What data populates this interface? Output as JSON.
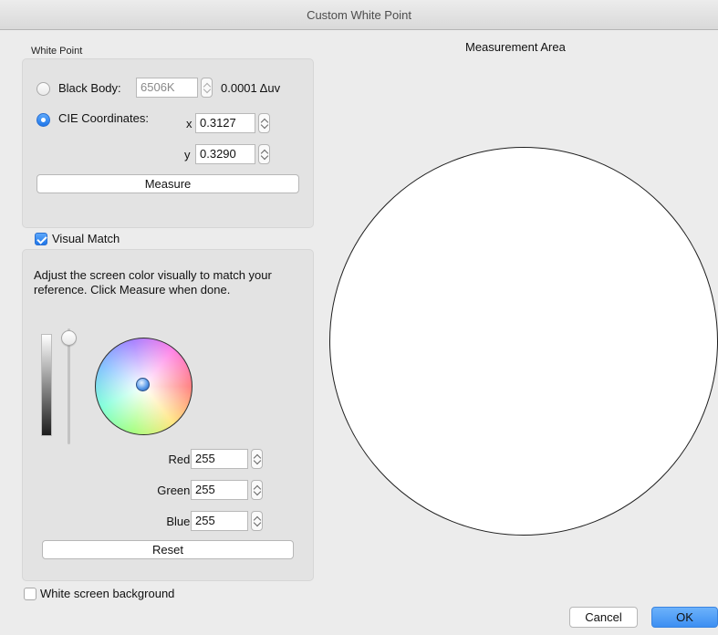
{
  "window": {
    "title": "Custom White Point"
  },
  "white_point": {
    "section_label": "White Point",
    "black_body": {
      "label": "Black Body:",
      "value": "6506K",
      "delta": "0.0001 Δuv",
      "selected": false
    },
    "cie": {
      "label": "CIE Coordinates:",
      "selected": true,
      "x_label": "x",
      "x_value": "0.3127",
      "y_label": "y",
      "y_value": "0.3290"
    },
    "measure_button": "Measure"
  },
  "visual_match": {
    "checkbox_label": "Visual Match",
    "checked": true,
    "instructions": "Adjust the screen color visually to match your reference. Click Measure when done.",
    "brightness_level": 1.0,
    "red_label": "Red:",
    "red_value": "255",
    "green_label": "Green:",
    "green_value": "255",
    "blue_label": "Blue:",
    "blue_value": "255",
    "reset_button": "Reset"
  },
  "measurement_area": {
    "title": "Measurement Area"
  },
  "footer": {
    "white_bg_label": "White screen background",
    "white_bg_checked": false,
    "cancel_button": "Cancel",
    "ok_button": "OK"
  },
  "colors": {
    "accent": "#1f76e9",
    "ok_button": "#5aa3f8",
    "window_bg": "#ececec"
  }
}
